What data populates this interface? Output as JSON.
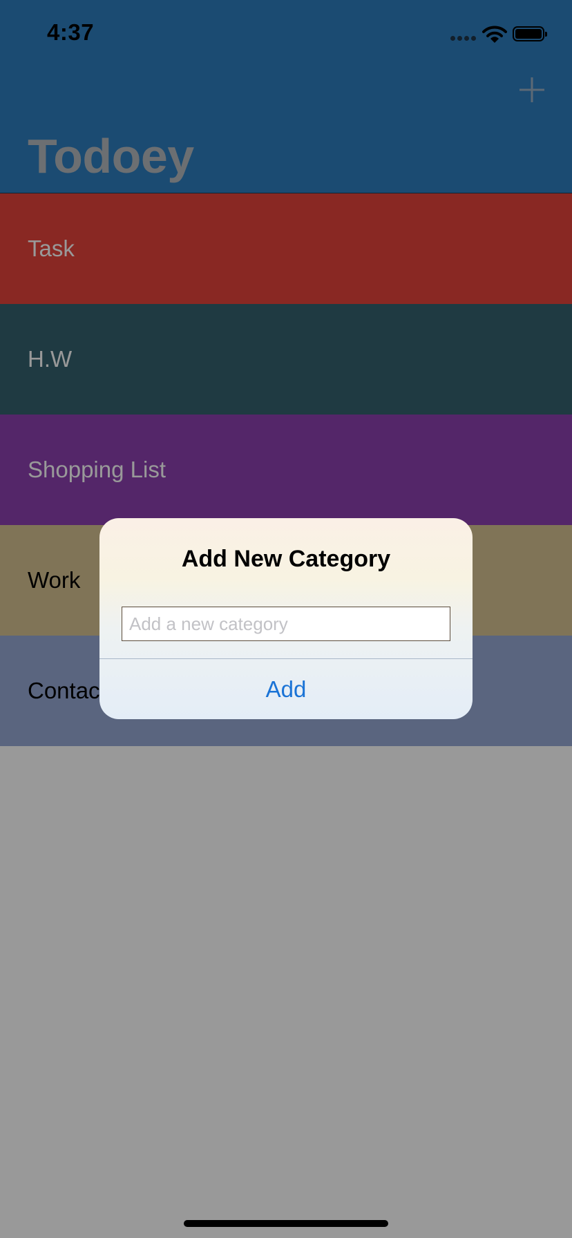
{
  "status_bar": {
    "time": "4:37",
    "icons": [
      "signal-dots-icon",
      "wifi-icon",
      "battery-icon"
    ]
  },
  "nav": {
    "title": "Todoey",
    "add_icon": "plus-icon",
    "color": "#2d7ebf"
  },
  "categories": [
    {
      "name": "Task",
      "color": "#e5433b",
      "text_color": "#ffffff"
    },
    {
      "name": "H.W",
      "color": "#34626f",
      "text_color": "#ffffff"
    },
    {
      "name": "Shopping List",
      "color": "#8c40b0",
      "text_color": "#ffffff"
    },
    {
      "name": "Work",
      "color": "#d5c291",
      "text_color": "#000000"
    },
    {
      "name": "Contacts",
      "color": "#97a8d4",
      "text_color": "#000000"
    }
  ],
  "alert": {
    "title": "Add New Category",
    "input_value": "",
    "input_placeholder": "Add a new category",
    "button_label": "Add",
    "button_color": "#1a73d6"
  }
}
